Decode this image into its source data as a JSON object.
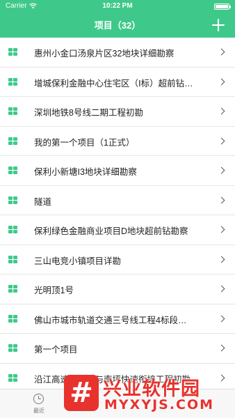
{
  "status_bar": {
    "carrier": "Carrier",
    "time": "10:22 PM"
  },
  "header": {
    "title": "项目（32）",
    "add_icon": "plus-icon"
  },
  "items": [
    {
      "label": "惠州小金口汤泉片区32地块详细勘察"
    },
    {
      "label": "增城保利金融中心住宅区（Ⅰ标）超前钻…"
    },
    {
      "label": "深圳地铁8号线二期工程初勘"
    },
    {
      "label": "我的第一个项目（1正式）"
    },
    {
      "label": "保利小新塘I3地块详细勘察"
    },
    {
      "label": "隧道"
    },
    {
      "label": "保利绿色金融商业项目D地块超前钻勘察"
    },
    {
      "label": "三山电竞小镇项目详勘"
    },
    {
      "label": "光明顶1号"
    },
    {
      "label": "佛山市城市轨道交通三号线工程4标段…"
    },
    {
      "label": "第一个项目"
    },
    {
      "label": "沿江高速前海段与南坪快速衔接工程初勘"
    }
  ],
  "tabbar": {
    "recent_label": "最近"
  },
  "watermark": {
    "title": "兴业软件园",
    "subtitle": "MYXYJS.COM"
  },
  "colors": {
    "accent": "#3ec98a",
    "watermark": "#e8322d"
  }
}
